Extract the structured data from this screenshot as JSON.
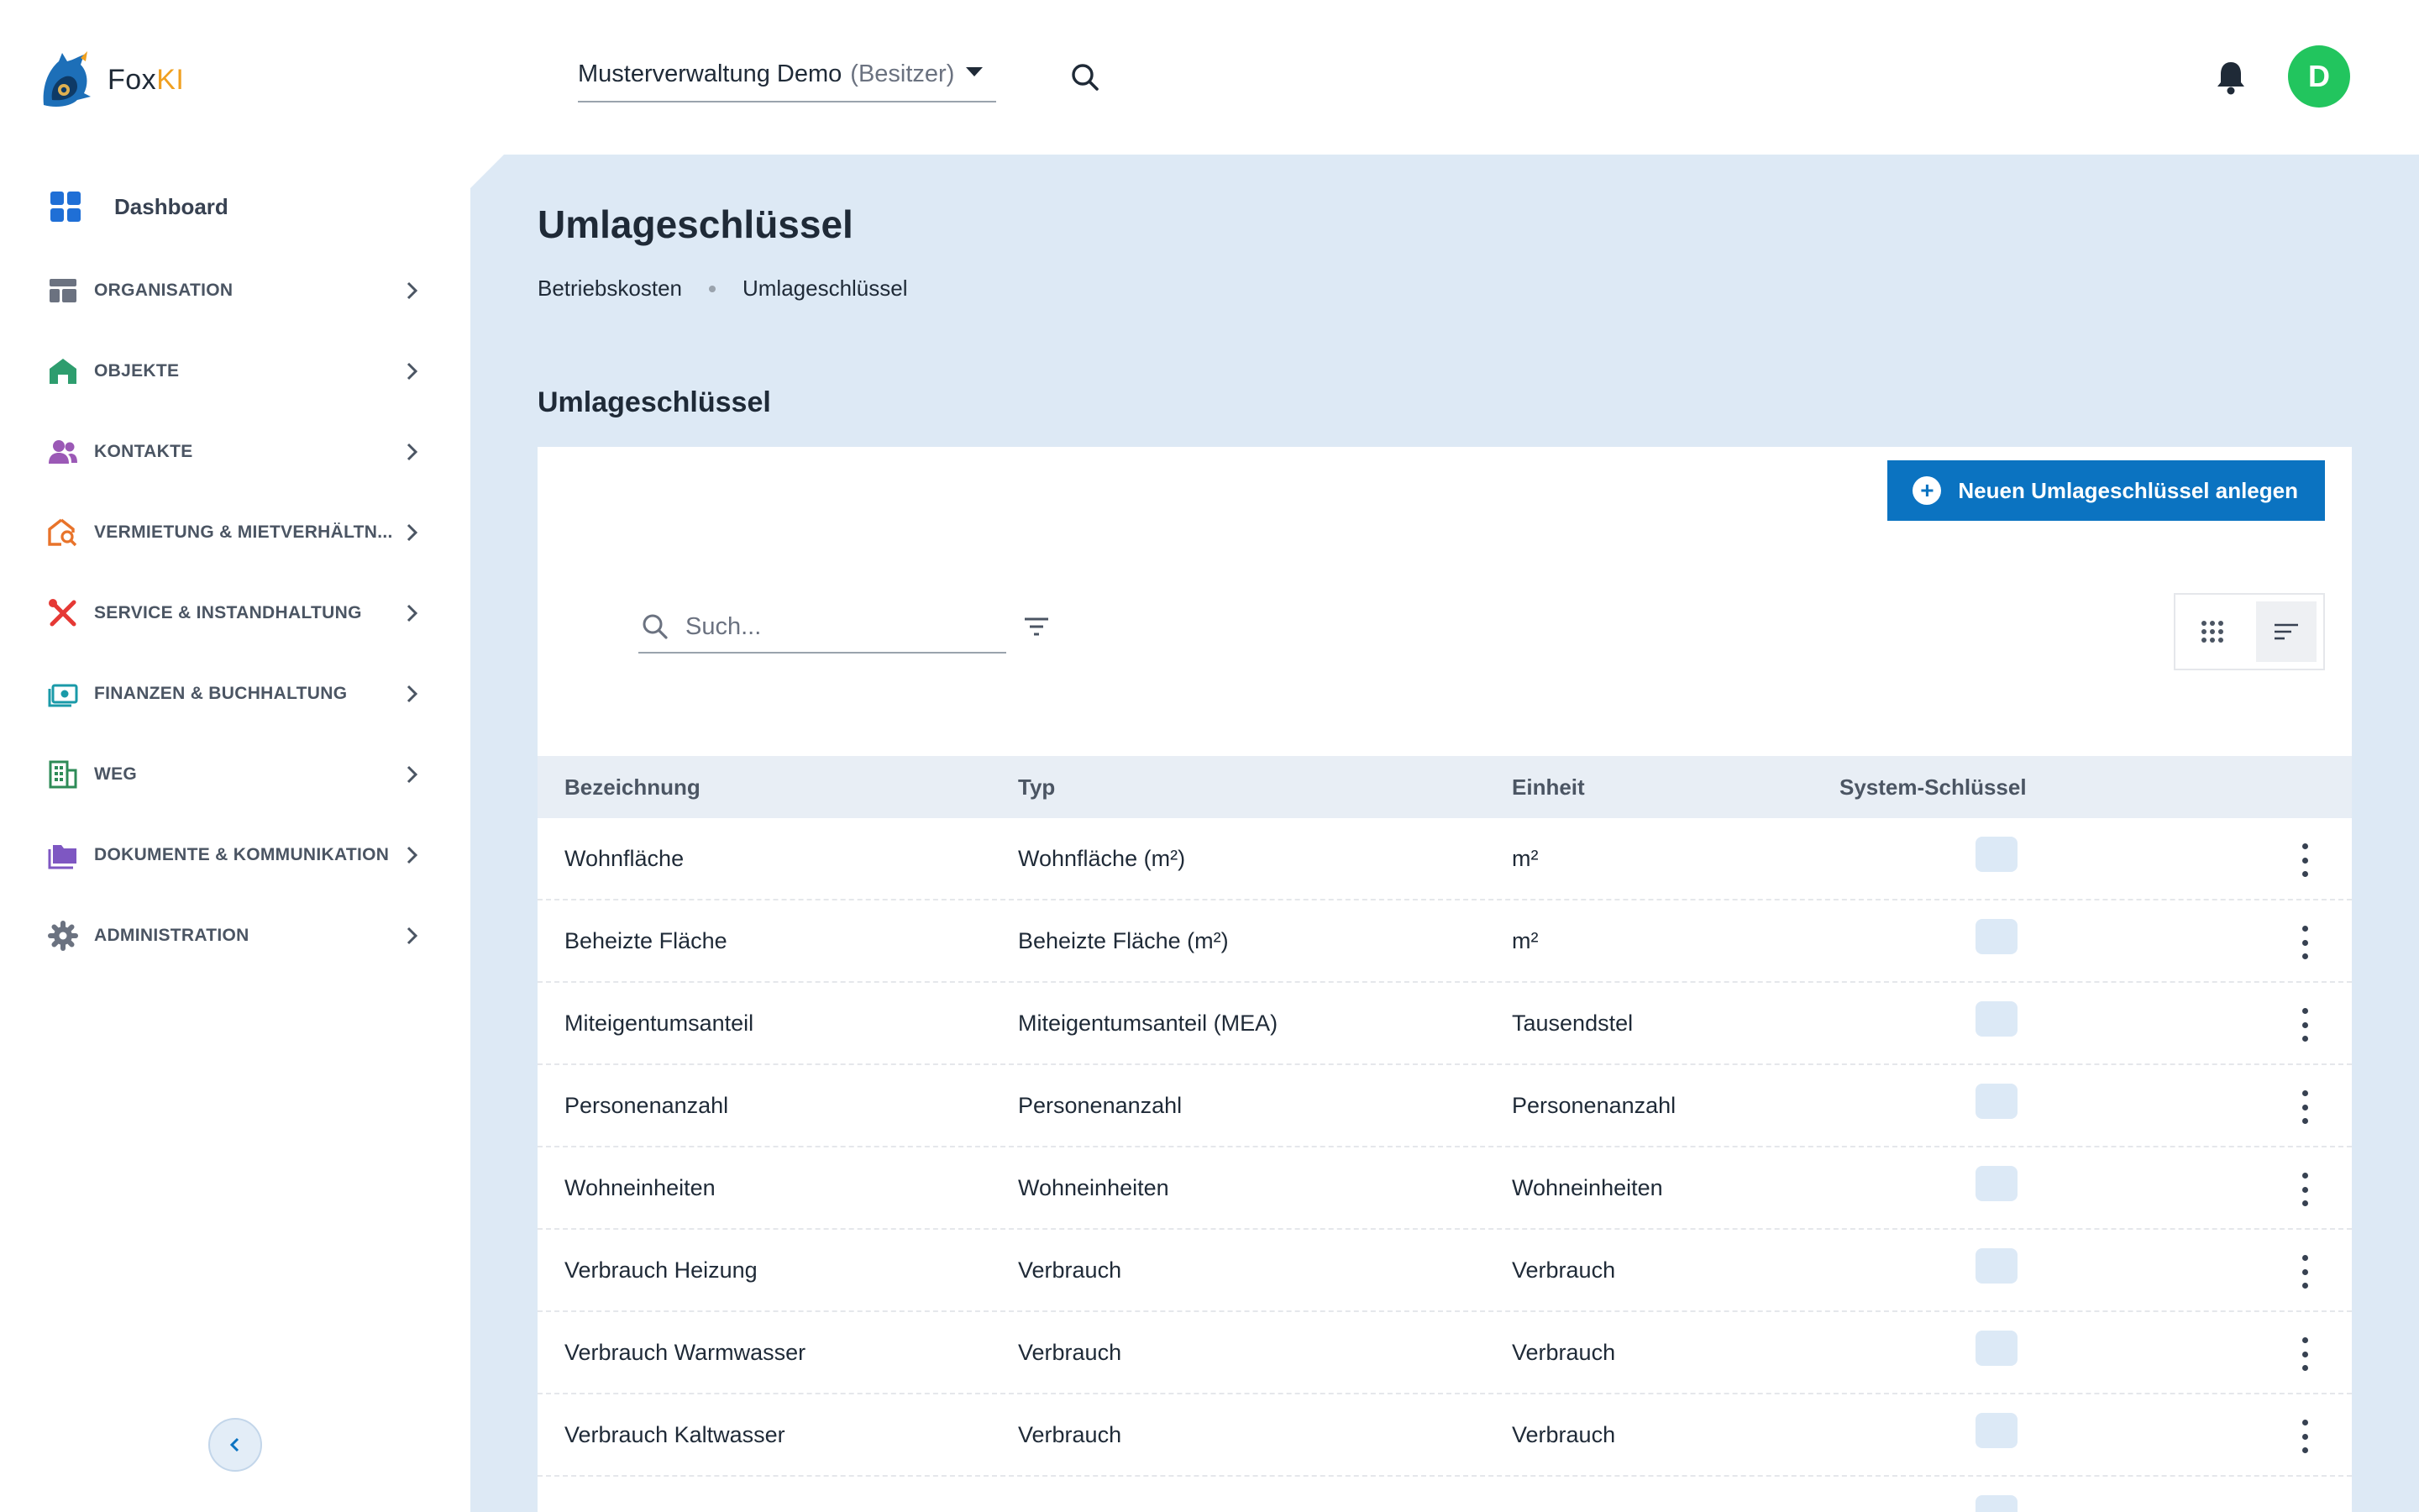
{
  "app": {
    "name_prefix": "Fox",
    "name_suffix": "KI"
  },
  "org_select": {
    "name": "Musterverwaltung Demo",
    "role": "(Besitzer)"
  },
  "user": {
    "initial": "D"
  },
  "sidebar": {
    "dashboard": "Dashboard",
    "items": [
      {
        "label": "ORGANISATION",
        "icon": "layout-icon",
        "color": "#6b7280"
      },
      {
        "label": "OBJEKTE",
        "icon": "home-icon",
        "color": "#2e9d6e"
      },
      {
        "label": "KONTAKTE",
        "icon": "people-icon",
        "color": "#9b59b6"
      },
      {
        "label": "VERMIETUNG & MIETVERHÄLTN...",
        "icon": "house-search-icon",
        "color": "#e8732a"
      },
      {
        "label": "SERVICE & INSTANDHALTUNG",
        "icon": "tools-icon",
        "color": "#e53935"
      },
      {
        "label": "FINANZEN & BUCHHALTUNG",
        "icon": "money-icon",
        "color": "#1a9aa8"
      },
      {
        "label": "WEG",
        "icon": "building-icon",
        "color": "#2e8b57"
      },
      {
        "label": "DOKUMENTE & KOMMUNIKATION",
        "icon": "folder-icon",
        "color": "#7e57c2"
      },
      {
        "label": "ADMINISTRATION",
        "icon": "gear-icon",
        "color": "#6b7280"
      }
    ]
  },
  "page": {
    "title": "Umlageschlüssel",
    "breadcrumb": [
      "Betriebskosten",
      "Umlageschlüssel"
    ],
    "section_title": "Umlageschlüssel",
    "new_button": "Neuen Umlageschlüssel anlegen",
    "search_placeholder": "Such..."
  },
  "table": {
    "headers": [
      "Bezeichnung",
      "Typ",
      "Einheit",
      "System-Schlüssel"
    ],
    "rows": [
      [
        "Wohnfläche",
        "Wohnfläche (m²)",
        "m²"
      ],
      [
        "Beheizte Fläche",
        "Beheizte Fläche (m²)",
        "m²"
      ],
      [
        "Miteigentumsanteil",
        "Miteigentumsanteil (MEA)",
        "Tausendstel"
      ],
      [
        "Personenanzahl",
        "Personenanzahl",
        "Personenanzahl"
      ],
      [
        "Wohneinheiten",
        "Wohneinheiten",
        "Wohneinheiten"
      ],
      [
        "Verbrauch Heizung",
        "Verbrauch",
        "Verbrauch"
      ],
      [
        "Verbrauch Warmwasser",
        "Verbrauch",
        "Verbrauch"
      ],
      [
        "Verbrauch Kaltwasser",
        "Verbrauch",
        "Verbrauch"
      ]
    ]
  },
  "colors": {
    "accent": "#0b73c1",
    "main_bg": "#dde9f5",
    "avatar": "#22c55e"
  }
}
